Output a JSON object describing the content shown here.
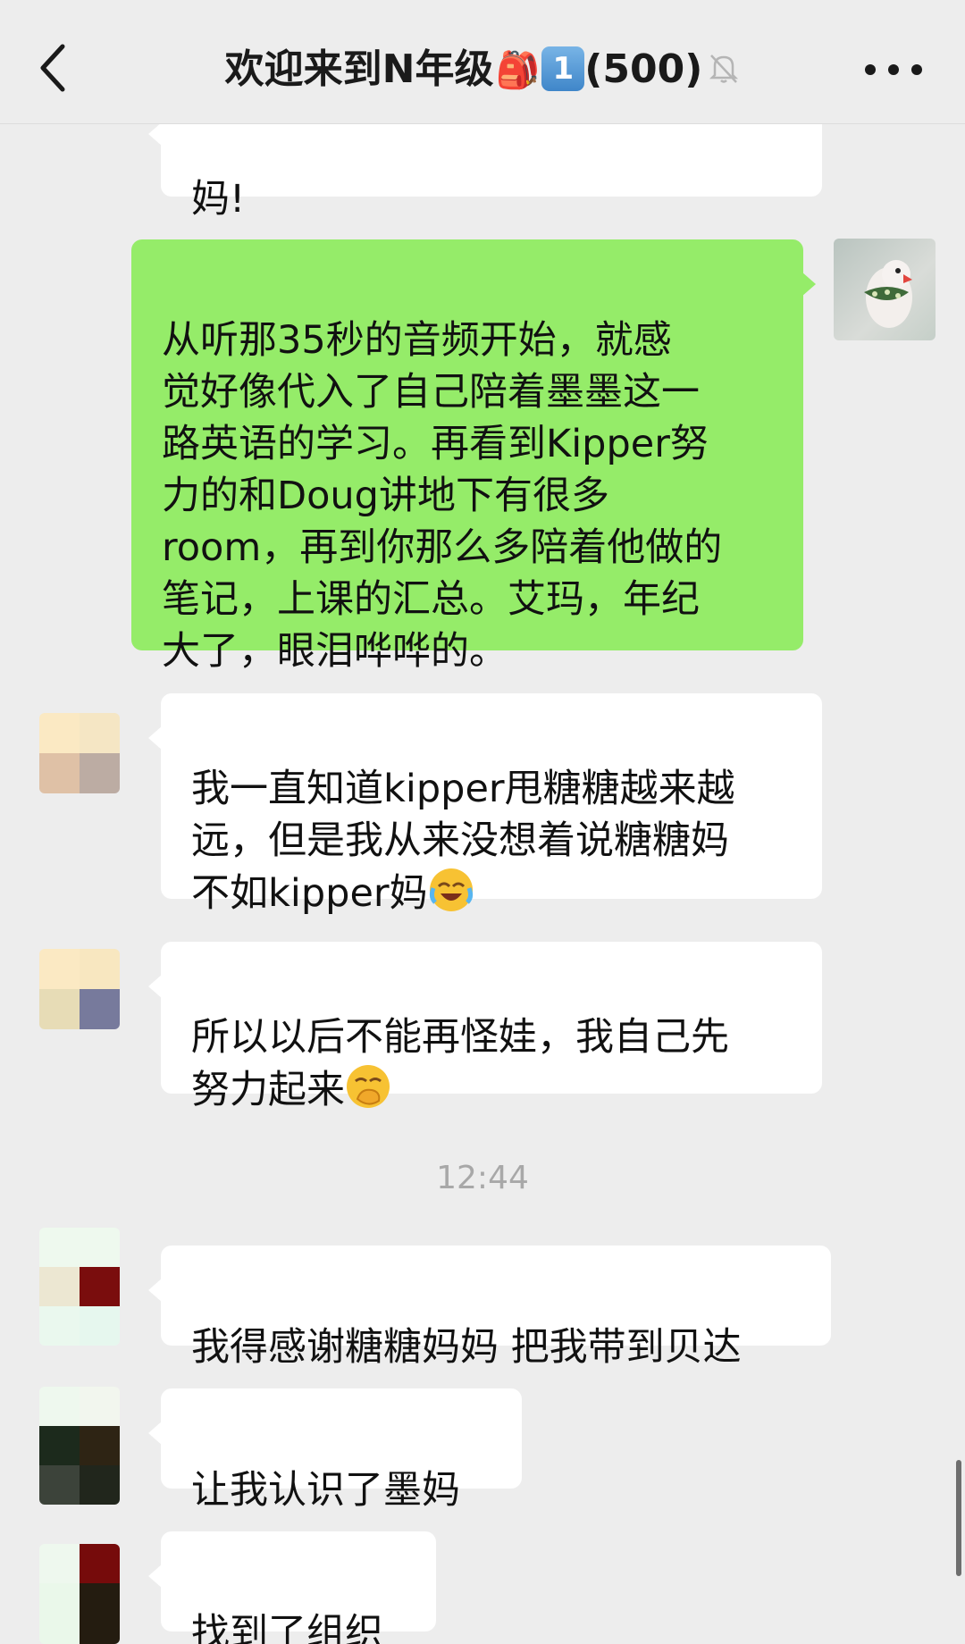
{
  "header": {
    "title": "欢迎来到N年级",
    "backpack_emoji": "🎒",
    "keycap": "1",
    "member_count": "(500)"
  },
  "messages": [
    {
      "id": "m0",
      "side": "in",
      "text": "妈!"
    },
    {
      "id": "m1",
      "side": "out",
      "text": "从听那35秒的音频开始，就感\n觉好像代入了自己陪着墨墨这一\n路英语的学习。再看到Kipper努\n力的和Doug讲地下有很多\nroom，再到你那么多陪着他做的\n笔记，上课的汇总。艾玛，年纪\n大了，眼泪哗哗的。"
    },
    {
      "id": "m2",
      "side": "in",
      "text": "我一直知道kipper甩糖糖越来越\n远，但是我从来没想着说糖糖妈\n不如kipper妈"
    },
    {
      "id": "m3",
      "side": "in",
      "text": "所以以后不能再怪娃，我自己先\n努力起来"
    },
    {
      "id": "m4",
      "side": "in",
      "text": "我得感谢糖糖妈妈 把我带到贝达"
    },
    {
      "id": "m5",
      "side": "in",
      "text": "让我认识了墨妈"
    },
    {
      "id": "m6",
      "side": "in",
      "text": "找到了组织"
    }
  ],
  "timestamp": "12:44",
  "colors": {
    "background": "#ededed",
    "bubble_in": "#ffffff",
    "bubble_out": "#95ec69",
    "timestamp": "#a8a8a8"
  },
  "icons": {
    "back": "chevron-left-icon",
    "muted": "bell-slash-icon",
    "more": "more-dots-icon",
    "laugh_cry": "rolling-laughing-emoji",
    "hand_over_mouth": "hand-over-mouth-emoji"
  }
}
